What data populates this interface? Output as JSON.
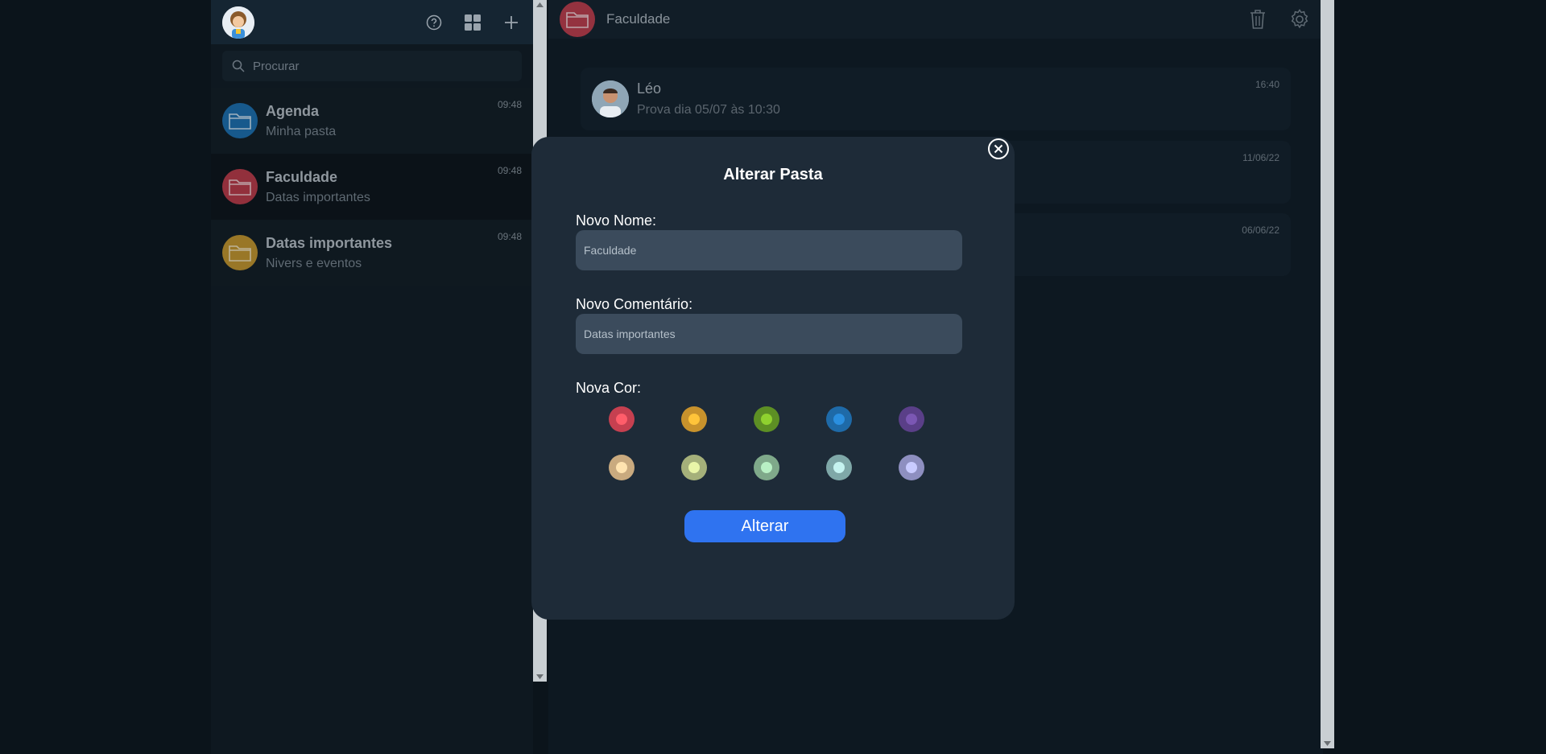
{
  "sidebar": {
    "search_placeholder": "Procurar",
    "folders": [
      {
        "title": "Agenda",
        "subtitle": "Minha pasta",
        "time": "09:48",
        "color": "#1a6fb0"
      },
      {
        "title": "Faculdade",
        "subtitle": "Datas importantes",
        "time": "09:48",
        "color": "#c03a48"
      },
      {
        "title": "Datas importantes",
        "subtitle": "Nivers e eventos",
        "time": "09:48",
        "color": "#c7972a"
      }
    ]
  },
  "chat": {
    "title": "Faculdade",
    "folder_color": "#c03a48",
    "messages": [
      {
        "name": "Léo",
        "text": "Prova dia 05/07 às 10:30",
        "time": "16:40"
      },
      {
        "name": "",
        "text": "",
        "time": "11/06/22"
      },
      {
        "name": "",
        "text": "",
        "time": "06/06/22"
      }
    ]
  },
  "modal": {
    "title": "Alterar Pasta",
    "name_label": "Novo Nome:",
    "name_placeholder": "Faculdade",
    "comment_label": "Novo Comentário:",
    "comment_placeholder": "Datas importantes",
    "color_label": "Nova Cor:",
    "submit_label": "Alterar",
    "colors": [
      {
        "ring": "#c64050",
        "dot": "#ff5d6a"
      },
      {
        "ring": "#c8922c",
        "dot": "#ffc43a"
      },
      {
        "ring": "#5d8f24",
        "dot": "#8fd12f"
      },
      {
        "ring": "#1e6aa8",
        "dot": "#2a8fe0"
      },
      {
        "ring": "#5a3f88",
        "dot": "#7b57b3"
      },
      {
        "ring": "#c9aa7f",
        "dot": "#ffe3b0"
      },
      {
        "ring": "#a5b07a",
        "dot": "#e9f5a8"
      },
      {
        "ring": "#7fa98a",
        "dot": "#b8f0c4"
      },
      {
        "ring": "#7fa8a8",
        "dot": "#c5f3f0"
      },
      {
        "ring": "#8e8fc0",
        "dot": "#c9cbff"
      }
    ]
  }
}
